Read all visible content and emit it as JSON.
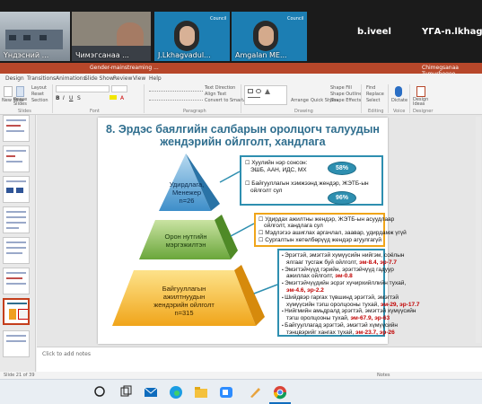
{
  "meeting": {
    "participants": [
      {
        "name": "Үндэсний ..."
      },
      {
        "name": "Чимэгсанаа ..."
      },
      {
        "name": "J.Lkhagvadul..."
      },
      {
        "name": "Amgalan ME..."
      }
    ],
    "name_only_tiles": [
      {
        "name": "b.iveel"
      },
      {
        "name": "ҮГА-n.lkhagvak"
      }
    ],
    "logo_text": "Council"
  },
  "app": {
    "doc_title": "Gender-mainstreaming ...",
    "user": "Chimegsanaa Tumurbogoo"
  },
  "menu": {
    "items": [
      "Design",
      "Transitions",
      "Animations",
      "Slide Show",
      "Review",
      "View",
      "Help"
    ]
  },
  "ribbon": {
    "new_slide": "New Slide",
    "reuse_slides": "Reuse Slides",
    "layout": "Layout",
    "reset": "Reset",
    "section": "Section",
    "text_direction": "Text Direction",
    "align_text": "Align Text",
    "convert_smartart": "Convert to SmartArt",
    "arrange": "Arrange",
    "quick_styles": "Quick Styles",
    "shape_fill": "Shape Fill",
    "shape_outline": "Shape Outline",
    "shape_effects": "Shape Effects",
    "find": "Find",
    "replace": "Replace",
    "select": "Select",
    "dictate": "Dictate",
    "design_ideas": "Design Ideas",
    "groups": {
      "slides": "Slides",
      "font": "Font",
      "paragraph": "Paragraph",
      "drawing": "Drawing",
      "editing": "Editing",
      "voice": "Voice",
      "designer": "Designer"
    }
  },
  "slide": {
    "title_line1": "8. Эрдэс баялгийн салбарын оролцогч талуудын",
    "title_line2": "жендэрийн ойлголт, хандлага",
    "tiers": {
      "top": [
        "Удирдлага,",
        "Менежер",
        "n=26"
      ],
      "middle": [
        "Орон нутгийн",
        "мэргэжилтэн"
      ],
      "bottom": [
        "Байгууллагын",
        "ажилтнуудын",
        "жендэрийн ойлголт",
        "n=315"
      ]
    },
    "box_top": {
      "item1_line1": "Хуулийн нэр сонсон:",
      "item1_line2": "ЭШБ, ААН, ИДС, МХ",
      "item1_pct": "58%",
      "item2_line1": "Байгууллагын хэмжээнд жендэр, ЖЭТБ-ын",
      "item2_line2": "ойлголт сул",
      "item2_pct": "96%"
    },
    "box_middle": [
      "Удирдах ажилтны жендэр, ЖЭТБ-ын асуудлаар",
      "ойлголт, хандлага сул",
      "Мэдлэгээ ашиглах аргачлал, заавар, удирдамж үгүй",
      "Сургалтын хөтөлбөрүүд жендэр агуулгагүй"
    ],
    "box_bottom": [
      {
        "text": "Эрэгтэй, эмэгтэй хүмүүсийн нийгэм, соёлын",
        "em": ""
      },
      {
        "text": "ялгааг тусгаж буй ойлголт, ",
        "em": "эм-8.4, эр-7.7"
      },
      {
        "text": "Эмэгтэйчүүд гэрийн, эрэгтэйчүүд гадуур",
        "em": ""
      },
      {
        "text": "ажиллах ойлголт, ",
        "em": "эм-0.8"
      },
      {
        "text": "Эмэгтэйчүүдийн эсрэг хүчирхийллийн тухай,",
        "em": ""
      },
      {
        "text": "",
        "em": "эм-4.6, эр-2.2"
      },
      {
        "text": "Шийдвэр гаргах түвшинд эрэгтэй, эмэгтэй",
        "em": ""
      },
      {
        "text": "хүмүүсийн тэгш оролцооны тухай, ",
        "em": "эм-29, эр-17.7"
      },
      {
        "text": "Нийгмийн амьдралд эрэгтэй, эмэгтэй хүмүүсийн",
        "em": ""
      },
      {
        "text": "тэгш оролцооны тухай, ",
        "em": "эм-67.9, эр-63"
      },
      {
        "text": "Байгууллагад эрэгтэй, эмэгтэй хүмүүсийн",
        "em": ""
      },
      {
        "text": "тэнцвэрийг хангах тухай, ",
        "em": "эм-23.7, эр-26"
      }
    ]
  },
  "notes": {
    "placeholder": "Click to add notes"
  },
  "status": {
    "left": "Slide 21 of 39",
    "right": "Notes"
  },
  "taskbar": {
    "search": "Search"
  }
}
